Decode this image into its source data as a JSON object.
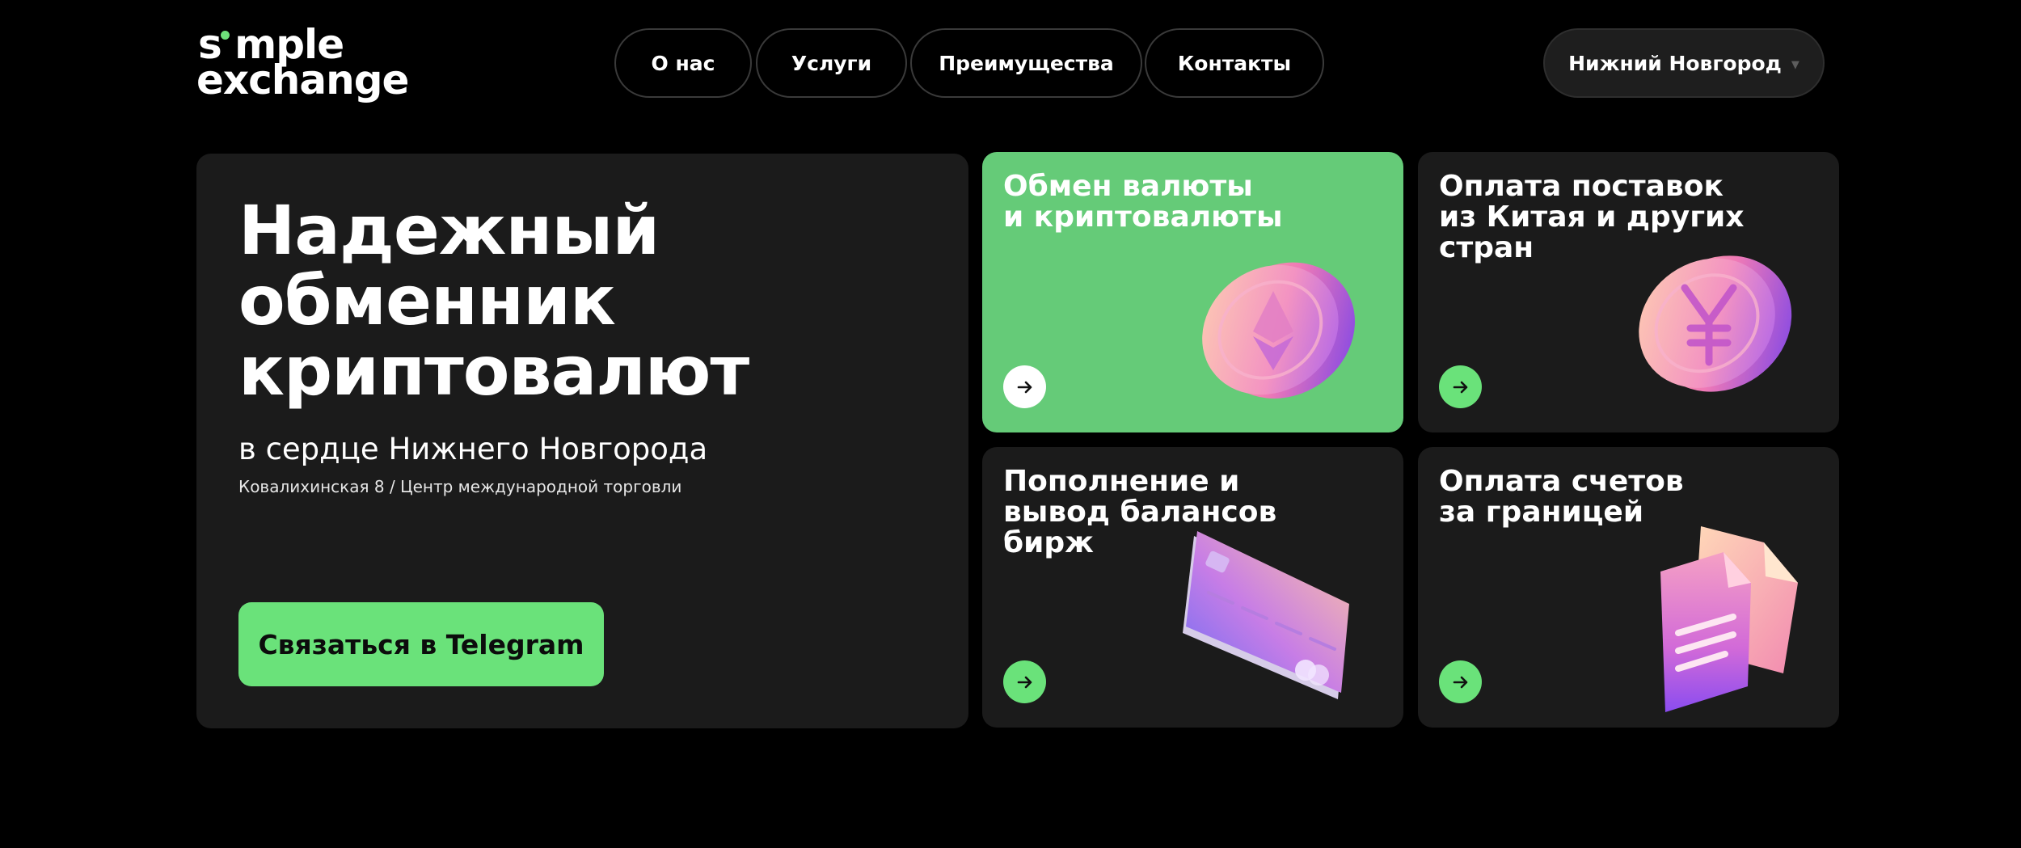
{
  "logo": {
    "line1": "simple",
    "line2": "exchange",
    "line1_display": "s mple",
    "accent": "#6ee27a"
  },
  "nav": {
    "items": [
      {
        "label": "О нас"
      },
      {
        "label": "Услуги"
      },
      {
        "label": "Преимущества"
      },
      {
        "label": "Контакты"
      }
    ]
  },
  "city": {
    "label": "Нижний Новгород",
    "icon": "chevron-down-icon"
  },
  "hero": {
    "title": "Надежный\nобменник\nкриптовалют",
    "subtitle": "в сердце Нижнего Новгорода",
    "address": "Ковалихинская 8 / Центр международной торговли",
    "button": "Связаться в Telegram"
  },
  "services": [
    {
      "title": "Обмен валюты\nи криптовалюты",
      "icon": "ethereum-coin-icon",
      "arrow_icon": "arrow-right-icon"
    },
    {
      "title": "Оплата поставок\nиз Китая и других\nстран",
      "icon": "yuan-coin-icon",
      "arrow_icon": "arrow-right-icon"
    },
    {
      "title": "Пополнение и\nвывод балансов\nбирж",
      "icon": "credit-card-icon",
      "arrow_icon": "arrow-right-icon"
    },
    {
      "title": "Оплата счетов\nза границей",
      "icon": "documents-icon",
      "arrow_icon": "arrow-right-icon"
    }
  ],
  "colors": {
    "background": "#000000",
    "card": "#1b1b1b",
    "accent_green": "#6ae27a",
    "card_green": "#65cb78"
  }
}
